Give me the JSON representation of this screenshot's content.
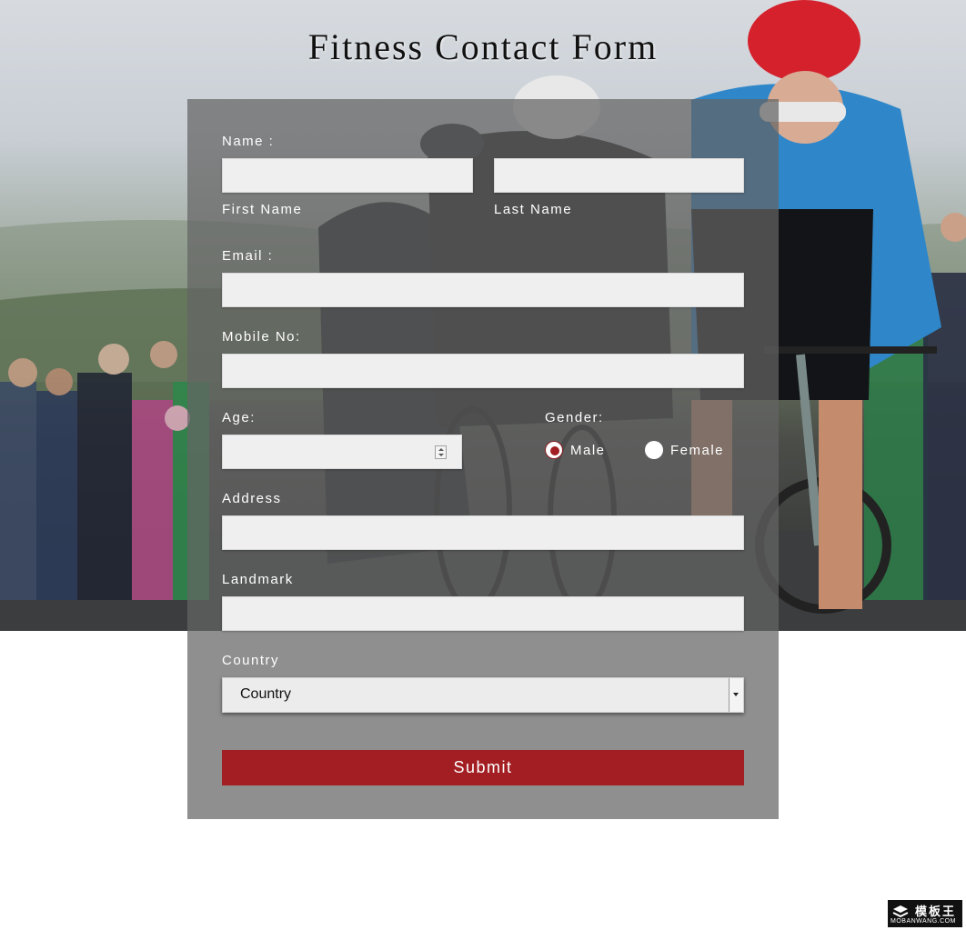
{
  "page": {
    "title": "Fitness Contact Form"
  },
  "form": {
    "name_label": "Name :",
    "first_name_sublabel": "First Name",
    "last_name_sublabel": "Last Name",
    "first_name_value": "",
    "last_name_value": "",
    "email_label": "Email :",
    "email_value": "",
    "mobile_label": "Mobile No:",
    "mobile_value": "",
    "age_label": "Age:",
    "age_value": "",
    "gender_label": "Gender:",
    "gender_options": [
      "Male",
      "Female"
    ],
    "gender_selected": "Male",
    "address_label": "Address",
    "address_value": "",
    "landmark_label": "Landmark",
    "landmark_value": "",
    "country_label": "Country",
    "country_selected": "Country",
    "submit_label": "Submit"
  },
  "watermark": {
    "text": "模板王",
    "subtext": "MOBANWANG.COM"
  },
  "colors": {
    "accent": "#a21e22",
    "panel": "#646464",
    "field_bg": "#efefef"
  },
  "icons": {
    "age_spinner": "spinner-icon",
    "country_dropdown": "chevron-down-icon",
    "watermark_logo": "stack-logo-icon"
  }
}
